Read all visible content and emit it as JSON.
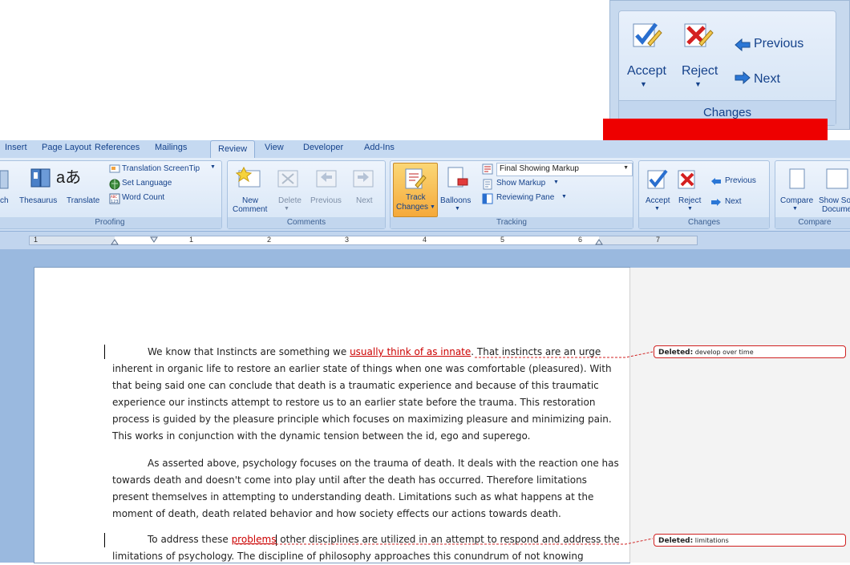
{
  "zoom": {
    "accept": "Accept",
    "reject": "Reject",
    "previous": "Previous",
    "next": "Next",
    "group": "Changes"
  },
  "tabs": [
    "Insert",
    "Page Layout",
    "References",
    "Mailings",
    "Review",
    "View",
    "Developer",
    "Add-Ins"
  ],
  "proofing": {
    "research": "ch",
    "thesaurus": "Thesaurus",
    "translate": "Translate",
    "screentip": "Translation ScreenTip",
    "setlang": "Set Language",
    "wordcount": "Word Count",
    "label": "Proofing"
  },
  "comments": {
    "new_line1": "New",
    "new_line2": "Comment",
    "delete": "Delete",
    "previous": "Previous",
    "next": "Next",
    "label": "Comments"
  },
  "tracking": {
    "track_line1": "Track",
    "track_line2": "Changes",
    "balloons": "Balloons",
    "display": "Final Showing Markup",
    "show_markup": "Show Markup",
    "reviewing_pane": "Reviewing Pane",
    "label": "Tracking"
  },
  "changes": {
    "accept": "Accept",
    "reject": "Reject",
    "previous": "Previous",
    "next": "Next",
    "label": "Changes"
  },
  "compare": {
    "compare": "Compare",
    "show_source_1": "Show So",
    "show_source_2": "Docume",
    "label": "Compare"
  },
  "ruler_numbers": [
    "1",
    "1",
    "2",
    "3",
    "4",
    "5",
    "6",
    "7"
  ],
  "doc": {
    "p1": {
      "a": "We know that Instincts are something we ",
      "ins": "usually think of as innate",
      "b": ". That instincts are an urge inherent in organic life to restore an earlier state of things when one was comfortable (pleasured). With that being said one can conclude that death is a traumatic experience and because of this traumatic experience our instincts attempt to restore us to an earlier state before the trauma. This restoration process is guided by the pleasure principle which focuses on maximizing pleasure and minimizing pain. This works in  conjunction with the dynamic tension between the id, ego and superego."
    },
    "p2": "As asserted above, psychology focuses on the trauma of death. It deals with the reaction one has towards death and doesn't come into play until after the death has occurred.  Therefore limitations present themselves in attempting to understanding death.  Limitations such as what happens at the moment of death, death related behavior and how society effects our actions towards death.",
    "p3": {
      "a": "To address these ",
      "ins": "problems",
      "b": " other disciplines are utilized in an attempt to respond and address the limitations of psychology.  The discipline of philosophy approaches this conundrum of not knowing"
    }
  },
  "balloons": [
    {
      "label": "Deleted:",
      "text": "develop over time"
    },
    {
      "label": "Deleted:",
      "text": "limitations"
    }
  ],
  "colors": {
    "pointer": "#ee0000",
    "insertion": "#cc0000",
    "ribbon_text": "#15428b"
  }
}
